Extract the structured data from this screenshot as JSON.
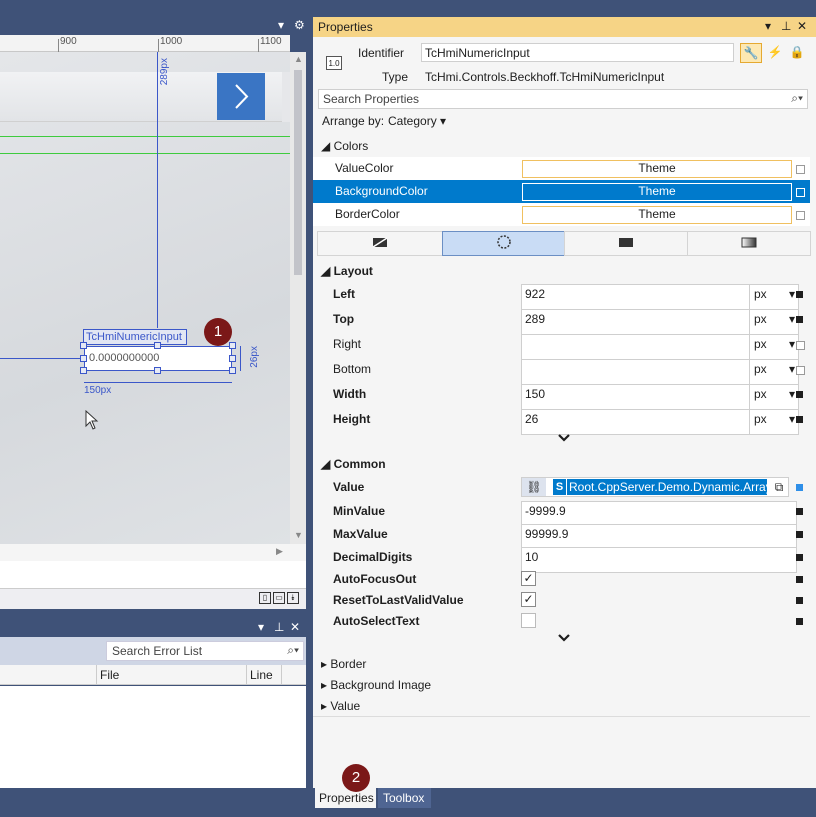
{
  "designer": {
    "ruler": {
      "labels": [
        "900",
        "1000",
        "1100"
      ]
    },
    "control_label": "TcHmiNumericInput",
    "control_value": "0.0000000000",
    "top_dimension": "289px",
    "height_dimension": "26px",
    "width_dimension": "150px"
  },
  "errorlist": {
    "search_placeholder": "Search Error List",
    "columns": [
      "File",
      "Line"
    ]
  },
  "markers": [
    "1",
    "2"
  ],
  "properties": {
    "title": "Properties",
    "identifier_label": "Identifier",
    "identifier_value": "TcHmiNumericInput",
    "type_label": "Type",
    "type_value": "TcHmi.Controls.Beckhoff.TcHmiNumericInput",
    "type_badge": "1.0",
    "search_placeholder": "Search Properties",
    "arrange_label": "Arrange by:",
    "arrange_value": "Category",
    "colors": {
      "category": "Colors",
      "items": [
        {
          "label": "ValueColor",
          "value": "Theme"
        },
        {
          "label": "BackgroundColor",
          "value": "Theme"
        },
        {
          "label": "BorderColor",
          "value": "Theme"
        }
      ]
    },
    "layout": {
      "category": "Layout",
      "items": [
        {
          "label": "Left",
          "value": "922",
          "unit": "px"
        },
        {
          "label": "Top",
          "value": "289",
          "unit": "px"
        },
        {
          "label": "Right",
          "value": "",
          "unit": "px"
        },
        {
          "label": "Bottom",
          "value": "",
          "unit": "px"
        },
        {
          "label": "Width",
          "value": "150",
          "unit": "px"
        },
        {
          "label": "Height",
          "value": "26",
          "unit": "px"
        }
      ]
    },
    "common": {
      "category": "Common",
      "value_label": "Value",
      "value_binding": "Root.CppServer.Demo.Dynamic.Array",
      "symbol_badge": "S",
      "items": [
        {
          "label": "MinValue",
          "value": "-9999.9"
        },
        {
          "label": "MaxValue",
          "value": "99999.9"
        },
        {
          "label": "DecimalDigits",
          "value": "10"
        }
      ],
      "checks": [
        {
          "label": "AutoFocusOut",
          "checked": true
        },
        {
          "label": "ResetToLastValidValue",
          "checked": true
        },
        {
          "label": "AutoSelectText",
          "checked": false
        }
      ]
    },
    "collapsed": [
      "Border",
      "Background Image",
      "Value"
    ],
    "bottom_tabs": [
      "Properties",
      "Toolbox"
    ]
  },
  "colors": {
    "accent": "#007acc",
    "title_bar": "#f6d486",
    "chrome": "#3f5278"
  }
}
